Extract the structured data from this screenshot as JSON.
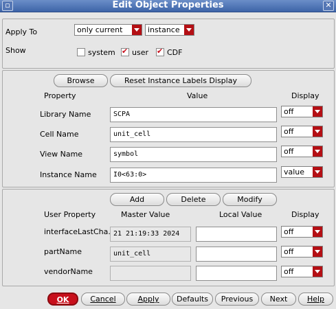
{
  "window": {
    "title": "Edit Object Properties"
  },
  "top": {
    "apply_to_label": "Apply To",
    "apply_scope": "only current",
    "apply_target": "instance",
    "show_label": "Show",
    "show_system": "system",
    "show_user": "user",
    "show_cdf": "CDF",
    "system_checked": false,
    "user_checked": true,
    "cdf_checked": true
  },
  "props": {
    "browse": "Browse",
    "reset": "Reset Instance Labels Display",
    "col_property": "Property",
    "col_value": "Value",
    "col_display": "Display",
    "rows": [
      {
        "label": "Library Name",
        "value": "SCPA",
        "display": "off"
      },
      {
        "label": "Cell Name",
        "value": "unit_cell",
        "display": "off"
      },
      {
        "label": "View Name",
        "value": "symbol",
        "display": "off"
      },
      {
        "label": "Instance Name",
        "value": "I0<63:0>",
        "display": "value"
      }
    ]
  },
  "user": {
    "add": "Add",
    "delete": "Delete",
    "modify": "Modify",
    "col_user_property": "User Property",
    "col_master_value": "Master Value",
    "col_local_value": "Local Value",
    "col_display": "Display",
    "rows": [
      {
        "label": "interfaceLastCha..",
        "master": "21 21:19:33 2024",
        "local": "",
        "display": "off"
      },
      {
        "label": "partName",
        "master": "unit_cell",
        "local": "",
        "display": "off"
      },
      {
        "label": "vendorName",
        "master": "",
        "local": "",
        "display": "off"
      }
    ]
  },
  "footer": {
    "ok": "OK",
    "cancel": "Cancel",
    "apply": "Apply",
    "defaults": "Defaults",
    "previous": "Previous",
    "next": "Next",
    "help": "Help"
  },
  "colors": {
    "accent_red": "#b40f14",
    "title_blue": "#4a6fb0"
  }
}
